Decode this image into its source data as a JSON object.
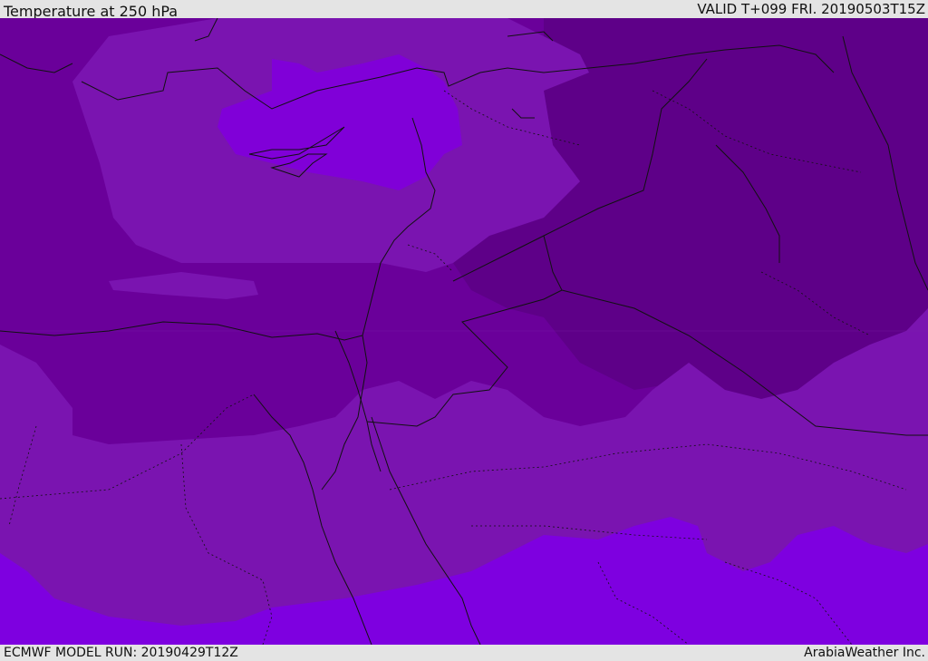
{
  "header": {
    "title": "Temperature at 250 hPa",
    "valid_time": "VALID T+099 FRI. 20190503T15Z"
  },
  "footer": {
    "model_run": "ECMWF MODEL RUN: 20190429T12Z",
    "credit": "ArabiaWeather Inc."
  },
  "map": {
    "region": "Eastern Mediterranean / Middle East",
    "palette": {
      "coldest": "#5e0088",
      "cold": "#6a009a",
      "mid": "#7a14b0",
      "warm": "#8000d8",
      "warmest": "#7e00e0"
    }
  }
}
